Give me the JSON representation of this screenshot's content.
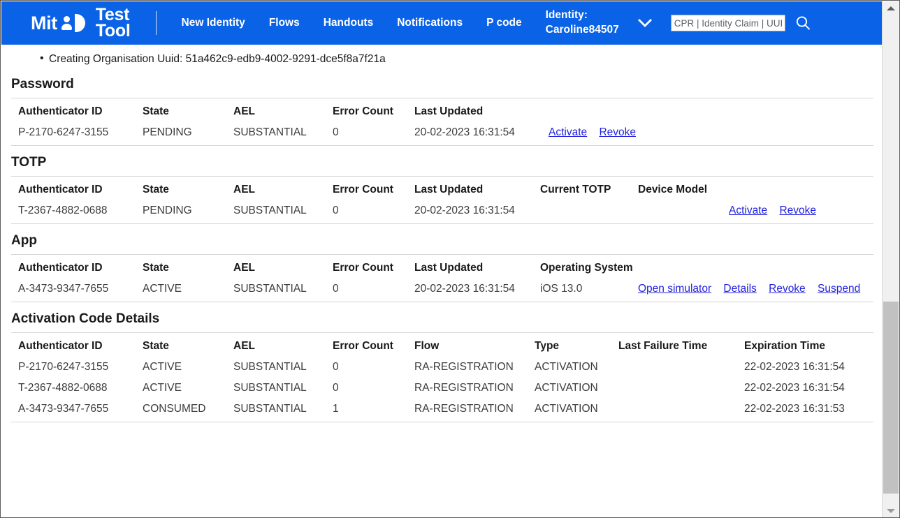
{
  "header": {
    "logo": {
      "mit": "Mit",
      "glyph": "person-d-icon",
      "test_tool": "Test\nTool",
      "test_line1": "Test",
      "test_line2": "Tool"
    },
    "nav": [
      {
        "label": "New Identity",
        "name": "nav-new-identity"
      },
      {
        "label": "Flows",
        "name": "nav-flows"
      },
      {
        "label": "Handouts",
        "name": "nav-handouts"
      },
      {
        "label": "Notifications",
        "name": "nav-notifications"
      },
      {
        "label": "P code",
        "name": "nav-p-code"
      }
    ],
    "identity": {
      "label": "Identity:",
      "value": "Caroline84507"
    },
    "dropdown_icon": "chevron-down-icon",
    "search": {
      "value": "",
      "placeholder": "CPR | Identity Claim | UUID",
      "button_icon": "search-icon"
    },
    "accent_color": "#0a62e6"
  },
  "breadcrumb": {
    "items": [
      "Creating Organisation Uuid: 51a462c9-edb9-4002-9291-dce5f8a7f21a"
    ]
  },
  "sections": {
    "password": {
      "title": "Password",
      "columns": [
        "Authenticator ID",
        "State",
        "AEL",
        "Error Count",
        "Last Updated",
        ""
      ],
      "rows": [
        {
          "authenticator_id": "P-2170-6247-3155",
          "state": "PENDING",
          "ael": "SUBSTANTIAL",
          "error_count": "0",
          "last_updated": "20-02-2023 16:31:54",
          "actions": [
            "Activate",
            "Revoke"
          ]
        }
      ]
    },
    "totp": {
      "title": "TOTP",
      "columns": [
        "Authenticator ID",
        "State",
        "AEL",
        "Error Count",
        "Last Updated",
        "Current TOTP",
        "Device Model",
        ""
      ],
      "rows": [
        {
          "authenticator_id": "T-2367-4882-0688",
          "state": "PENDING",
          "ael": "SUBSTANTIAL",
          "error_count": "0",
          "last_updated": "20-02-2023 16:31:54",
          "current_totp": "",
          "device_model": "",
          "actions": [
            "Activate",
            "Revoke"
          ]
        }
      ]
    },
    "app": {
      "title": "App",
      "columns": [
        "Authenticator ID",
        "State",
        "AEL",
        "Error Count",
        "Last Updated",
        "Operating System",
        ""
      ],
      "rows": [
        {
          "authenticator_id": "A-3473-9347-7655",
          "state": "ACTIVE",
          "ael": "SUBSTANTIAL",
          "error_count": "0",
          "last_updated": "20-02-2023 16:31:54",
          "operating_system": "iOS 13.0",
          "actions": [
            "Open simulator",
            "Details",
            "Revoke",
            "Suspend"
          ]
        }
      ]
    },
    "activation_code_details": {
      "title": "Activation Code Details",
      "columns": [
        "Authenticator ID",
        "State",
        "AEL",
        "Error Count",
        "Flow",
        "Type",
        "Last Failure Time",
        "Expiration Time"
      ],
      "rows": [
        {
          "authenticator_id": "P-2170-6247-3155",
          "state": "ACTIVE",
          "ael": "SUBSTANTIAL",
          "error_count": "0",
          "flow": "RA-REGISTRATION",
          "type": "ACTIVATION",
          "last_failure_time": "",
          "expiration_time": "22-02-2023 16:31:54"
        },
        {
          "authenticator_id": "T-2367-4882-0688",
          "state": "ACTIVE",
          "ael": "SUBSTANTIAL",
          "error_count": "0",
          "flow": "RA-REGISTRATION",
          "type": "ACTIVATION",
          "last_failure_time": "",
          "expiration_time": "22-02-2023 16:31:54"
        },
        {
          "authenticator_id": "A-3473-9347-7655",
          "state": "CONSUMED",
          "ael": "SUBSTANTIAL",
          "error_count": "1",
          "flow": "RA-REGISTRATION",
          "type": "ACTIVATION",
          "last_failure_time": "",
          "expiration_time": "22-02-2023 16:31:53"
        }
      ]
    }
  },
  "scrollbar": {
    "up_icon": "triangle-up-icon",
    "down_icon": "triangle-down-icon",
    "thumb": "scroll-thumb"
  }
}
